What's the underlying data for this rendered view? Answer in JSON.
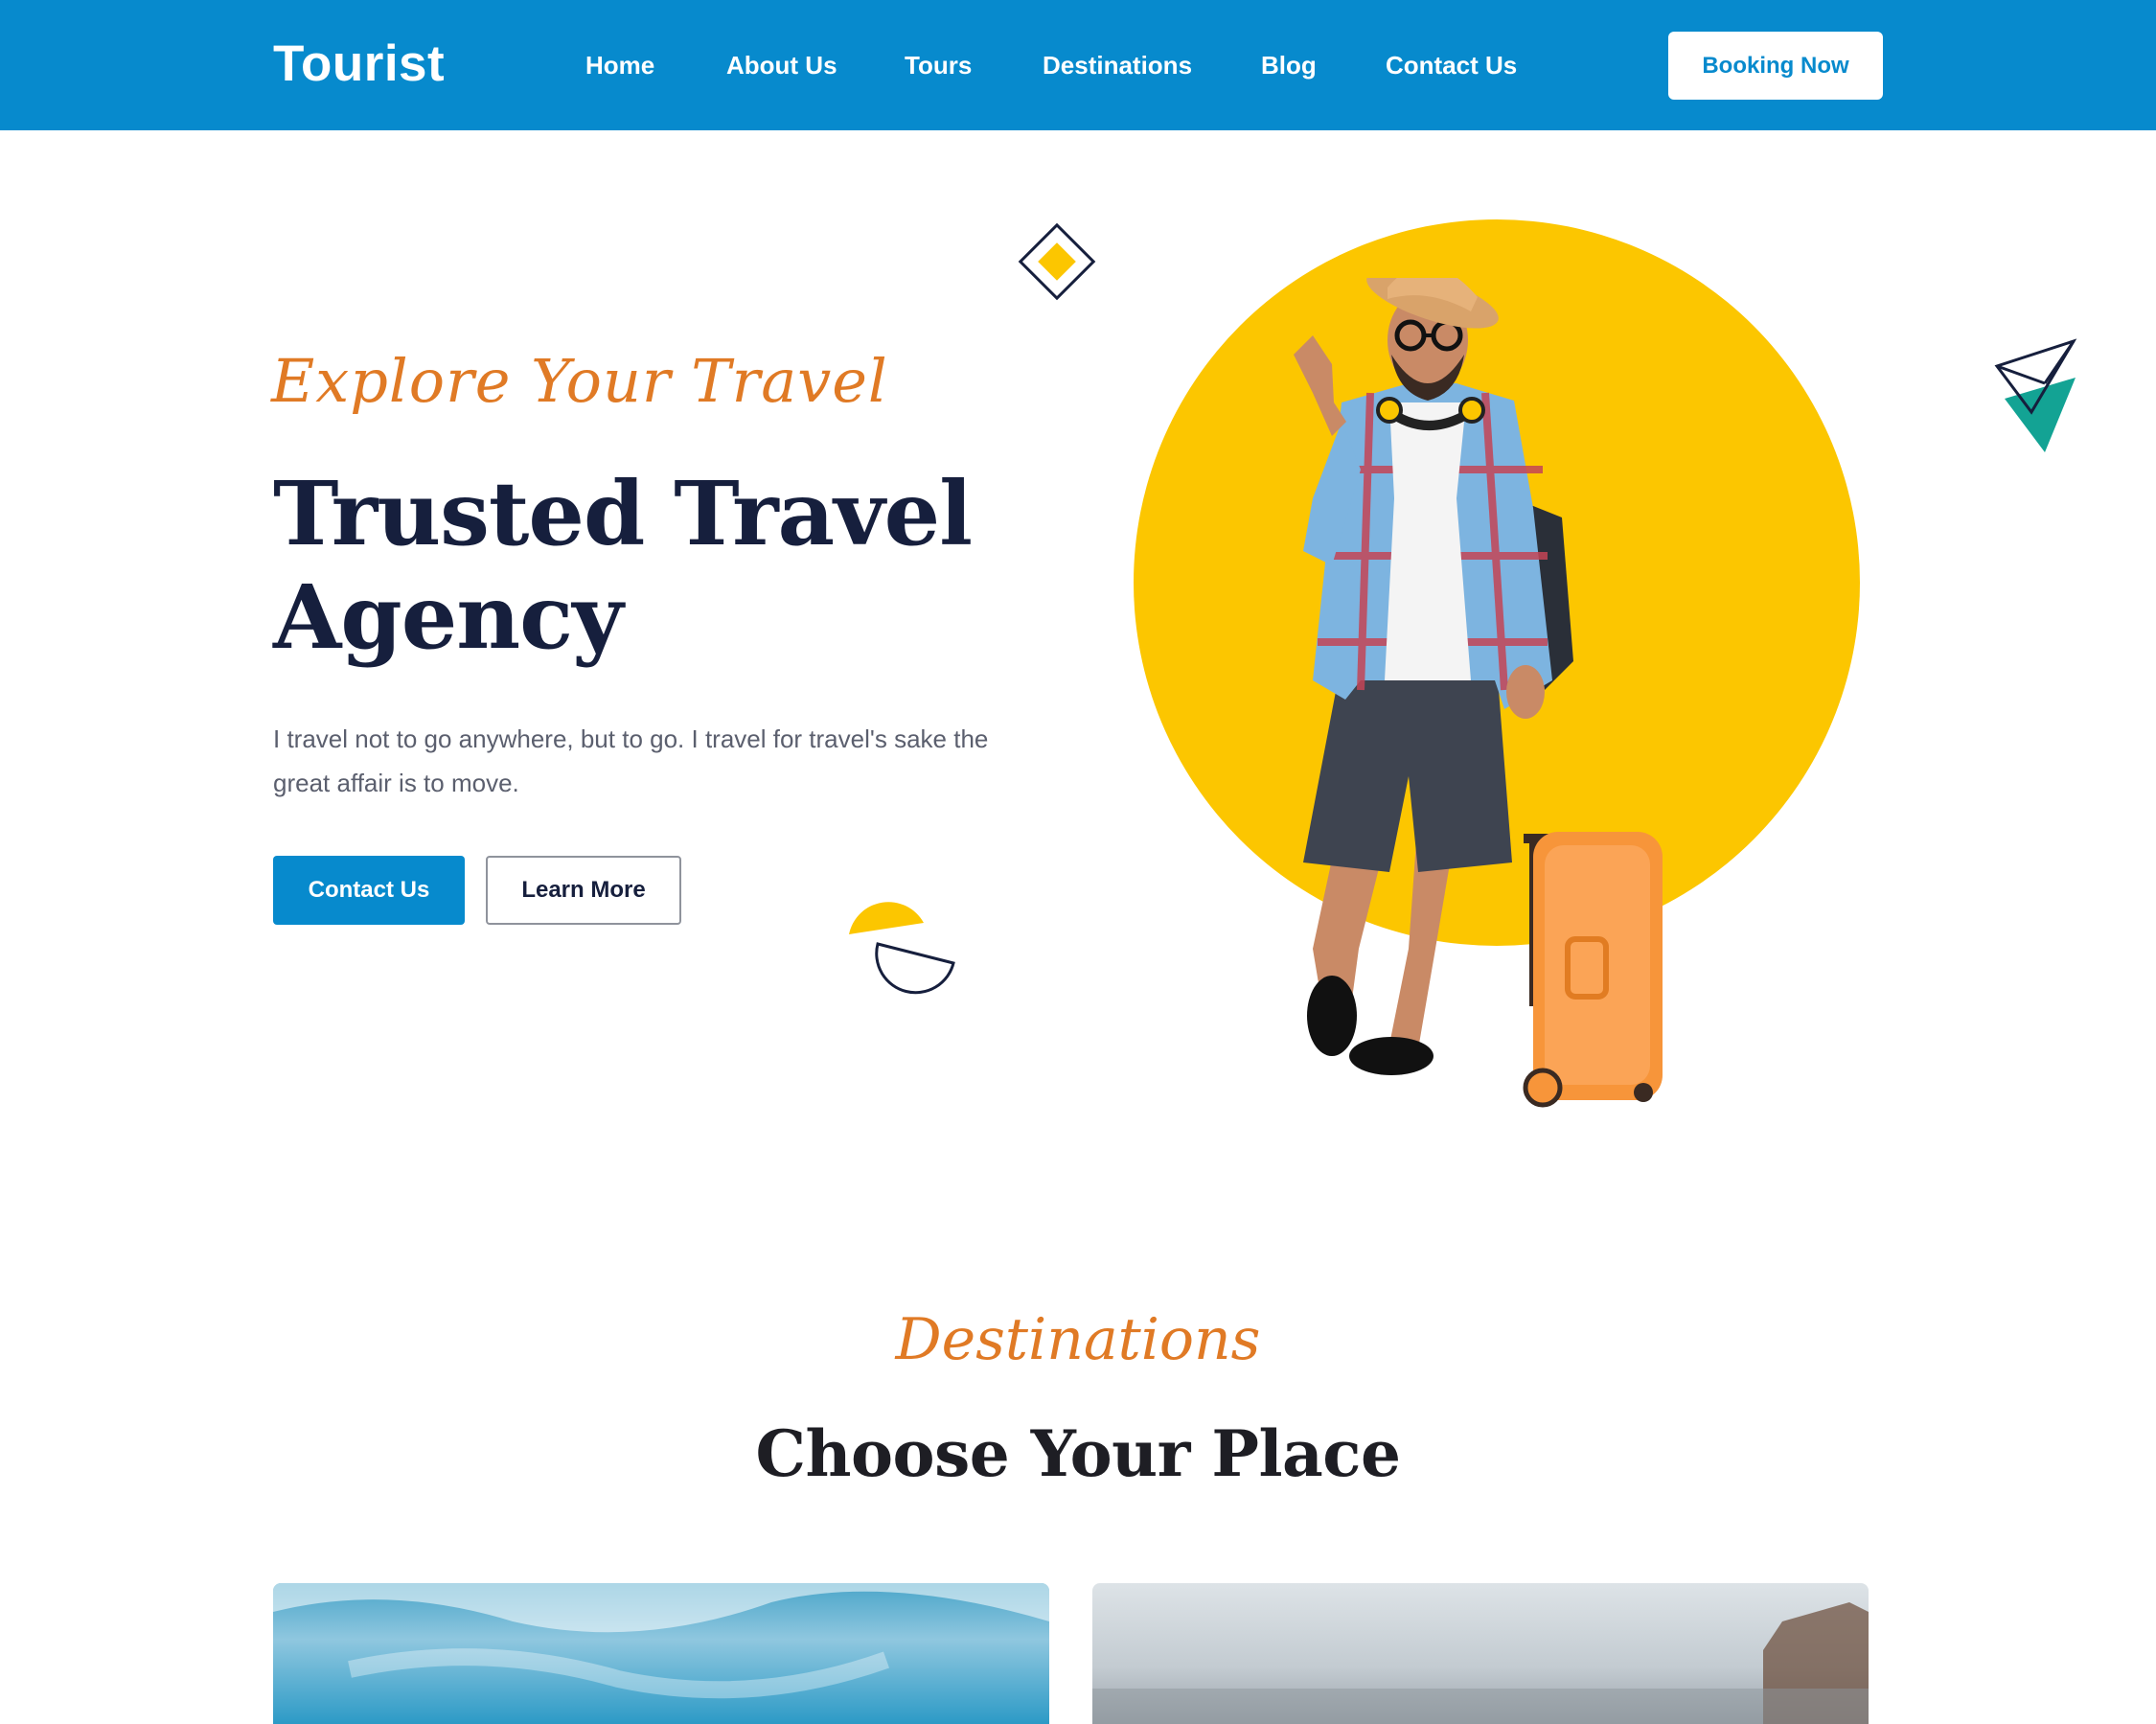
{
  "brand": {
    "name": "Tourist",
    "primary_color": "#078acd",
    "accent_color": "#e07a25",
    "yellow": "#fcc600"
  },
  "nav": {
    "items": [
      {
        "label": "Home"
      },
      {
        "label": "About Us"
      },
      {
        "label": "Tours"
      },
      {
        "label": "Destinations"
      },
      {
        "label": "Blog"
      },
      {
        "label": "Contact Us"
      }
    ],
    "cta": "Booking Now"
  },
  "hero": {
    "tagline": "Explore Your Travel",
    "title": "Trusted Travel Agency",
    "description": "I travel not to go anywhere, but to go. I travel for travel's sake the great affair is to move.",
    "primary_button": "Contact Us",
    "secondary_button": "Learn More"
  },
  "destinations": {
    "script_label": "Destinations",
    "title": "Choose Your Place"
  }
}
